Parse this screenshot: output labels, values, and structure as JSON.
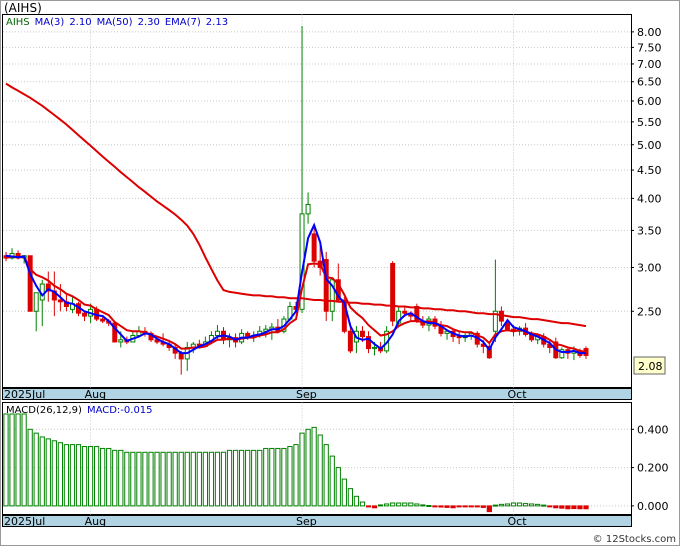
{
  "header": {
    "ticker": "(AIHS)",
    "legend": [
      {
        "text": "AIHS",
        "color": "#006400"
      },
      {
        "text": "MA(3)",
        "color": "#0000cc"
      },
      {
        "text": "2.10",
        "color": "#0000cc"
      },
      {
        "text": "MA(50)",
        "color": "#0000cc"
      },
      {
        "text": "2.30",
        "color": "#0000cc"
      },
      {
        "text": "EMA(7)",
        "color": "#0000cc"
      },
      {
        "text": "2.13",
        "color": "#0000cc"
      }
    ]
  },
  "macd_legend": [
    {
      "text": "MACD(26,12,9)",
      "color": "#000000"
    },
    {
      "text": "MACD:-0.015",
      "color": "#0000cc"
    }
  ],
  "credit": "© 12Stocks.com",
  "colors": {
    "up": "#008000",
    "down": "#dd0000",
    "ma3": "#0000ff",
    "ma50": "#dd0000",
    "strip": "#b0d4e4",
    "last_price_box": "#ffffcc"
  },
  "chart_data": [
    {
      "type": "candlestick",
      "scale": "log",
      "ylim": [
        1.82,
        8.6
      ],
      "y_ticks": [
        "8.00",
        "7.50",
        "7.00",
        "6.50",
        "6.00",
        "5.50",
        "5.00",
        "4.50",
        "4.00",
        "3.50",
        "3.00",
        "2.50"
      ],
      "last_price_label": "2.08",
      "x_labels": [
        {
          "label": "2025Jul",
          "index": 0
        },
        {
          "label": "Aug",
          "index": 14
        },
        {
          "label": "Sep",
          "index": 49
        },
        {
          "label": "Oct",
          "index": 84
        }
      ],
      "series": [
        {
          "name": "AIHS",
          "ohlc": [
            [
              3.15,
              3.2,
              3.08,
              3.12
            ],
            [
              3.12,
              3.25,
              3.1,
              3.18
            ],
            [
              3.18,
              3.22,
              3.1,
              3.12
            ],
            [
              3.12,
              3.16,
              3.05,
              3.15
            ],
            [
              3.15,
              3.15,
              2.5,
              2.5
            ],
            [
              2.5,
              2.7,
              2.3,
              2.7
            ],
            [
              2.62,
              2.85,
              2.35,
              2.8
            ],
            [
              2.8,
              2.95,
              2.6,
              2.72
            ],
            [
              2.72,
              2.95,
              2.45,
              2.62
            ],
            [
              2.62,
              2.8,
              2.5,
              2.6
            ],
            [
              2.6,
              2.68,
              2.5,
              2.55
            ],
            [
              2.52,
              2.65,
              2.48,
              2.58
            ],
            [
              2.58,
              2.6,
              2.45,
              2.48
            ],
            [
              2.48,
              2.5,
              2.4,
              2.45
            ],
            [
              2.45,
              2.58,
              2.38,
              2.52
            ],
            [
              2.52,
              2.55,
              2.4,
              2.42
            ],
            [
              2.42,
              2.45,
              2.38,
              2.4
            ],
            [
              2.4,
              2.42,
              2.35,
              2.38
            ],
            [
              2.38,
              2.4,
              2.2,
              2.2
            ],
            [
              2.2,
              2.3,
              2.15,
              2.22
            ],
            [
              2.22,
              2.25,
              2.18,
              2.2
            ],
            [
              2.2,
              2.3,
              2.2,
              2.26
            ],
            [
              2.26,
              2.35,
              2.24,
              2.3
            ],
            [
              2.3,
              2.34,
              2.25,
              2.28
            ],
            [
              2.28,
              2.3,
              2.2,
              2.22
            ],
            [
              2.22,
              2.25,
              2.18,
              2.2
            ],
            [
              2.2,
              2.28,
              2.16,
              2.18
            ],
            [
              2.18,
              2.2,
              2.12,
              2.15
            ],
            [
              2.15,
              2.18,
              2.05,
              2.1
            ],
            [
              2.1,
              2.12,
              1.92,
              2.05
            ],
            [
              2.05,
              2.2,
              1.95,
              2.15
            ],
            [
              2.15,
              2.2,
              2.1,
              2.18
            ],
            [
              2.18,
              2.22,
              2.14,
              2.16
            ],
            [
              2.16,
              2.25,
              2.15,
              2.2
            ],
            [
              2.2,
              2.3,
              2.18,
              2.26
            ],
            [
              2.26,
              2.36,
              2.22,
              2.3
            ],
            [
              2.3,
              2.34,
              2.18,
              2.22
            ],
            [
              2.22,
              2.28,
              2.15,
              2.24
            ],
            [
              2.24,
              2.28,
              2.15,
              2.2
            ],
            [
              2.2,
              2.32,
              2.18,
              2.28
            ],
            [
              2.28,
              2.3,
              2.22,
              2.25
            ],
            [
              2.25,
              2.3,
              2.2,
              2.26
            ],
            [
              2.26,
              2.35,
              2.24,
              2.3
            ],
            [
              2.3,
              2.36,
              2.24,
              2.32
            ],
            [
              2.32,
              2.38,
              2.22,
              2.34
            ],
            [
              2.34,
              2.42,
              2.28,
              2.3
            ],
            [
              2.3,
              2.45,
              2.28,
              2.42
            ],
            [
              2.42,
              2.6,
              2.4,
              2.55
            ],
            [
              2.55,
              2.6,
              2.5,
              2.52
            ],
            [
              2.52,
              8.2,
              2.48,
              3.75
            ],
            [
              3.75,
              4.1,
              3.6,
              3.9
            ],
            [
              3.45,
              3.55,
              3.0,
              3.08
            ],
            [
              3.08,
              3.3,
              2.9,
              3.0
            ],
            [
              3.1,
              3.2,
              2.4,
              2.5
            ],
            [
              2.5,
              2.85,
              2.4,
              2.85
            ],
            [
              2.85,
              3.05,
              2.6,
              2.62
            ],
            [
              2.62,
              2.65,
              2.28,
              2.3
            ],
            [
              2.3,
              2.38,
              2.1,
              2.12
            ],
            [
              2.2,
              2.35,
              2.1,
              2.3
            ],
            [
              2.3,
              2.35,
              2.2,
              2.25
            ],
            [
              2.25,
              2.3,
              2.1,
              2.14
            ],
            [
              2.14,
              2.2,
              2.08,
              2.15
            ],
            [
              2.15,
              2.2,
              2.1,
              2.12
            ],
            [
              2.12,
              2.35,
              2.1,
              2.3
            ],
            [
              3.05,
              3.08,
              2.35,
              2.4
            ],
            [
              2.38,
              2.55,
              2.35,
              2.5
            ],
            [
              2.5,
              2.55,
              2.44,
              2.48
            ],
            [
              2.48,
              2.5,
              2.4,
              2.45
            ],
            [
              2.55,
              2.58,
              2.38,
              2.4
            ],
            [
              2.4,
              2.45,
              2.33,
              2.36
            ],
            [
              2.36,
              2.45,
              2.3,
              2.42
            ],
            [
              2.42,
              2.45,
              2.32,
              2.35
            ],
            [
              2.35,
              2.4,
              2.25,
              2.28
            ],
            [
              2.28,
              2.32,
              2.22,
              2.3
            ],
            [
              2.3,
              2.32,
              2.2,
              2.25
            ],
            [
              2.25,
              2.3,
              2.18,
              2.24
            ],
            [
              2.24,
              2.28,
              2.2,
              2.26
            ],
            [
              2.26,
              2.3,
              2.22,
              2.28
            ],
            [
              2.28,
              2.3,
              2.15,
              2.18
            ],
            [
              2.18,
              2.22,
              2.1,
              2.16
            ],
            [
              2.16,
              2.2,
              2.05,
              2.06
            ],
            [
              2.3,
              3.1,
              2.2,
              2.5
            ],
            [
              2.5,
              2.55,
              2.35,
              2.4
            ],
            [
              2.38,
              2.42,
              2.3,
              2.32
            ],
            [
              2.32,
              2.36,
              2.25,
              2.3
            ],
            [
              2.3,
              2.35,
              2.26,
              2.33
            ],
            [
              2.33,
              2.38,
              2.25,
              2.27
            ],
            [
              2.27,
              2.3,
              2.2,
              2.22
            ],
            [
              2.22,
              2.28,
              2.18,
              2.25
            ],
            [
              2.25,
              2.28,
              2.15,
              2.18
            ],
            [
              2.18,
              2.22,
              2.1,
              2.15
            ],
            [
              2.2,
              2.24,
              2.05,
              2.06
            ],
            [
              2.06,
              2.15,
              2.05,
              2.13
            ],
            [
              2.13,
              2.15,
              2.05,
              2.1
            ],
            [
              2.1,
              2.16,
              2.04,
              2.12
            ],
            [
              2.12,
              2.14,
              2.06,
              2.08
            ],
            [
              2.14,
              2.16,
              2.05,
              2.08
            ]
          ]
        },
        {
          "name": "MA(3)",
          "values": [
            3.15,
            3.14,
            3.13,
            3.14,
            2.92,
            2.78,
            2.67,
            2.74,
            2.71,
            2.65,
            2.59,
            2.58,
            2.54,
            2.5,
            2.48,
            2.46,
            2.45,
            2.4,
            2.33,
            2.27,
            2.21,
            2.23,
            2.25,
            2.28,
            2.27,
            2.23,
            2.2,
            2.18,
            2.14,
            2.1,
            2.1,
            2.13,
            2.16,
            2.18,
            2.21,
            2.25,
            2.26,
            2.25,
            2.22,
            2.24,
            2.24,
            2.26,
            2.27,
            2.29,
            2.32,
            2.32,
            2.35,
            2.42,
            2.5,
            2.94,
            3.39,
            3.58,
            3.33,
            2.86,
            2.78,
            2.66,
            2.59,
            2.35,
            2.24,
            2.22,
            2.23,
            2.18,
            2.14,
            2.19,
            2.27,
            2.4,
            2.46,
            2.48,
            2.44,
            2.4,
            2.38,
            2.38,
            2.35,
            2.31,
            2.28,
            2.26,
            2.25,
            2.26,
            2.24,
            2.2,
            2.13,
            2.24,
            2.32,
            2.41,
            2.34,
            2.32,
            2.3,
            2.27,
            2.25,
            2.22,
            2.19,
            2.13,
            2.11,
            2.11,
            2.12,
            2.1,
            2.1
          ]
        },
        {
          "name": "MA(50)",
          "values": [
            6.45,
            6.35,
            6.26,
            6.17,
            6.08,
            5.98,
            5.88,
            5.77,
            5.66,
            5.55,
            5.44,
            5.32,
            5.2,
            5.09,
            4.98,
            4.87,
            4.76,
            4.66,
            4.56,
            4.46,
            4.37,
            4.28,
            4.19,
            4.11,
            4.03,
            3.95,
            3.88,
            3.81,
            3.74,
            3.66,
            3.57,
            3.45,
            3.3,
            3.13,
            2.98,
            2.84,
            2.73,
            2.71,
            2.7,
            2.69,
            2.68,
            2.67,
            2.67,
            2.66,
            2.66,
            2.65,
            2.65,
            2.64,
            2.64,
            2.64,
            2.63,
            2.62,
            2.62,
            2.61,
            2.61,
            2.6,
            2.6,
            2.59,
            2.59,
            2.58,
            2.58,
            2.57,
            2.57,
            2.56,
            2.56,
            2.55,
            2.55,
            2.54,
            2.54,
            2.53,
            2.53,
            2.52,
            2.52,
            2.51,
            2.51,
            2.5,
            2.5,
            2.49,
            2.48,
            2.48,
            2.47,
            2.47,
            2.46,
            2.45,
            2.44,
            2.44,
            2.43,
            2.42,
            2.42,
            2.41,
            2.4,
            2.39,
            2.38,
            2.38,
            2.37,
            2.36,
            2.35
          ]
        },
        {
          "name": "EMA(7)",
          "values": [
            3.12,
            3.14,
            3.13,
            3.14,
            2.98,
            2.91,
            2.88,
            2.84,
            2.78,
            2.74,
            2.69,
            2.66,
            2.62,
            2.57,
            2.56,
            2.52,
            2.49,
            2.46,
            2.39,
            2.35,
            2.31,
            2.3,
            2.3,
            2.29,
            2.27,
            2.25,
            2.23,
            2.21,
            2.18,
            2.14,
            2.14,
            2.15,
            2.15,
            2.16,
            2.19,
            2.22,
            2.22,
            2.23,
            2.22,
            2.23,
            2.24,
            2.24,
            2.26,
            2.27,
            2.29,
            2.29,
            2.32,
            2.38,
            2.42,
            2.75,
            3.04,
            3.05,
            3.04,
            2.88,
            2.87,
            2.8,
            2.68,
            2.54,
            2.48,
            2.43,
            2.36,
            2.31,
            2.26,
            2.27,
            2.3,
            2.35,
            2.38,
            2.4,
            2.4,
            2.39,
            2.4,
            2.38,
            2.36,
            2.35,
            2.32,
            2.3,
            2.29,
            2.29,
            2.26,
            2.24,
            2.19,
            2.27,
            2.3,
            2.31,
            2.3,
            2.31,
            2.3,
            2.28,
            2.27,
            2.25,
            2.22,
            2.18,
            2.17,
            2.15,
            2.14,
            2.12,
            2.11
          ]
        }
      ]
    },
    {
      "type": "bar",
      "y_ticks": [
        "0.400",
        "0.200",
        "0.000"
      ],
      "ylim": [
        -0.045,
        0.54
      ],
      "x_labels": [
        {
          "label": "2025Jul",
          "index": 0
        },
        {
          "label": "Aug",
          "index": 14
        },
        {
          "label": "Sep",
          "index": 49
        },
        {
          "label": "Oct",
          "index": 84
        }
      ],
      "series": [
        {
          "name": "MACD",
          "values": [
            0.48,
            0.48,
            0.48,
            0.48,
            0.4,
            0.38,
            0.36,
            0.35,
            0.34,
            0.33,
            0.32,
            0.32,
            0.32,
            0.31,
            0.31,
            0.31,
            0.3,
            0.3,
            0.29,
            0.29,
            0.28,
            0.28,
            0.28,
            0.28,
            0.28,
            0.28,
            0.28,
            0.28,
            0.28,
            0.28,
            0.28,
            0.28,
            0.28,
            0.28,
            0.28,
            0.28,
            0.28,
            0.29,
            0.29,
            0.29,
            0.29,
            0.29,
            0.29,
            0.3,
            0.3,
            0.3,
            0.3,
            0.31,
            0.32,
            0.38,
            0.4,
            0.41,
            0.37,
            0.32,
            0.26,
            0.2,
            0.14,
            0.09,
            0.05,
            0.02,
            -0.005,
            -0.01,
            0.005,
            0.01,
            0.015,
            0.015,
            0.015,
            0.015,
            0.01,
            0.005,
            0.002,
            -0.003,
            -0.006,
            -0.008,
            -0.01,
            -0.005,
            -0.004,
            -0.003,
            -0.005,
            -0.008,
            -0.03,
            0.004,
            0.008,
            0.01,
            0.015,
            0.015,
            0.012,
            0.01,
            0.008,
            0.004,
            -0.004,
            -0.01,
            -0.012,
            -0.015,
            -0.014,
            -0.015,
            -0.015
          ]
        }
      ]
    }
  ]
}
